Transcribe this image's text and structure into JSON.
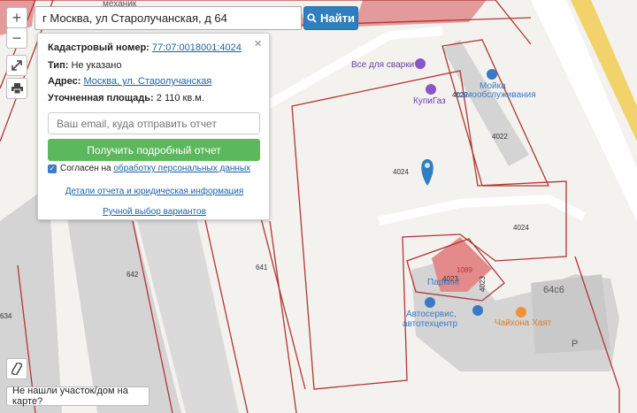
{
  "search": {
    "value": "г Москва, ул Старолучанская, д 64",
    "button_label": "Найти"
  },
  "controls": {
    "zoom_in": "+",
    "zoom_out": "−"
  },
  "popup": {
    "cadastral_label": "Кадастровый номер:",
    "cadastral_value": "77:07:0018001:4024",
    "type_label": "Тип:",
    "type_value": "Не указано",
    "address_label": "Адрес:",
    "address_value": "Москва, ул. Старолучанская",
    "area_label": "Уточненная площадь:",
    "area_value": "2 110 кв.м.",
    "email_placeholder": "Ваш email, куда отправить отчет",
    "report_button": "Получить подробный отчет",
    "agree_prefix": "Согласен на",
    "agree_link": "обработку персональных данных",
    "details_prefix": "Детали",
    "details_link": "отчета и юридическая информация",
    "manual_link": "Ручной выбор вариантов",
    "close": "×"
  },
  "map": {
    "labels": {
      "mekhanik": "механик",
      "p4022a": "4022",
      "p4022b": "4022",
      "p4024a": "4024",
      "p4024b": "4024",
      "p4023a": "4023",
      "p4023b": "4023",
      "p1089": "1089",
      "p641": "641",
      "p642": "642",
      "p634": "634",
      "p64s6": "64с6",
      "letter_r": "Р",
      "parking": "Паркинг",
      "vse_dlya_svarki": "Все для сварки",
      "kupi_gaz": "КупиГаз",
      "moyka": "Мойка",
      "samoobsluzhivaniya": "самообслуживания",
      "autoservice1": "Автосервис,",
      "autoservice2": "автотехцентр",
      "chaikhona": "Чайхона Хаят"
    }
  },
  "bottom": {
    "not_found": "Не нашли участок/дом на карте?"
  }
}
